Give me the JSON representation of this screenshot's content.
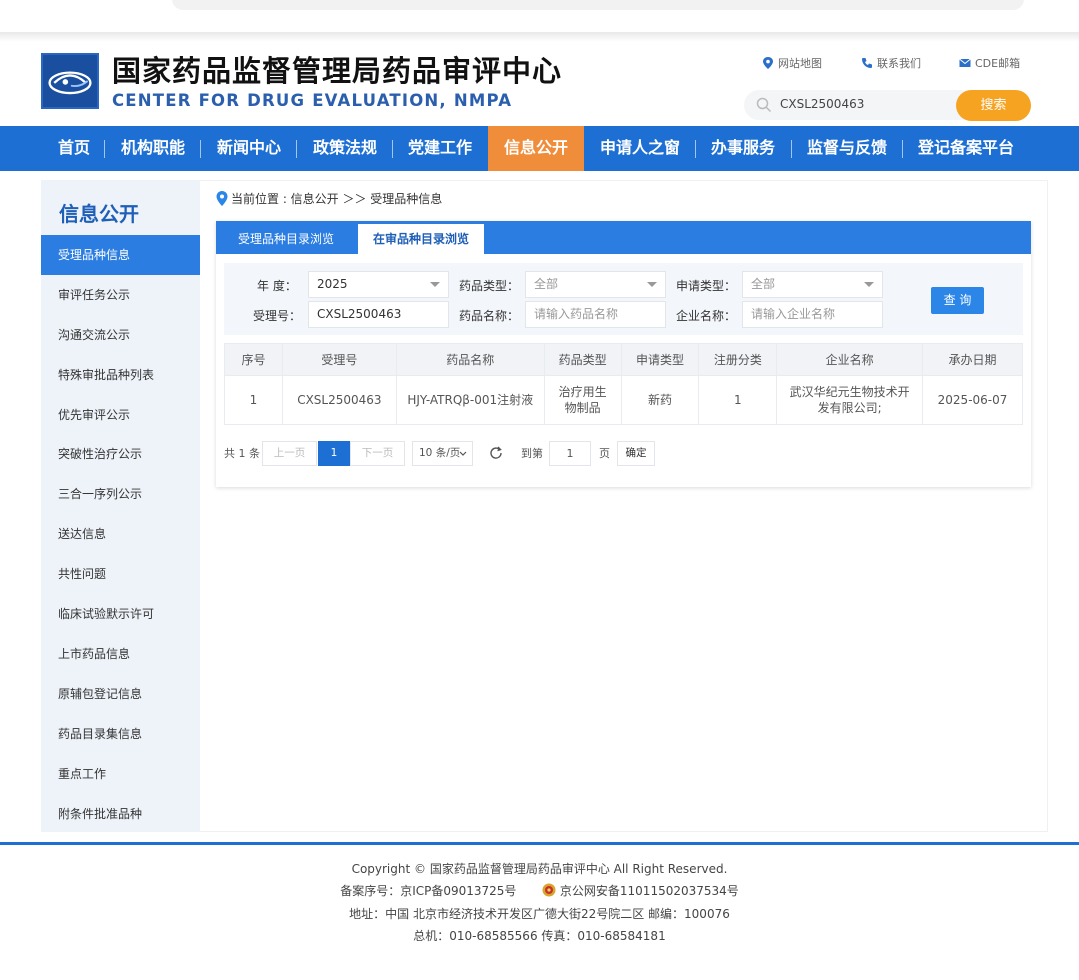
{
  "header": {
    "title": "国家药品监督管理局药品审评中心",
    "subtitle": "CENTER FOR DRUG EVALUATION, NMPA",
    "links": [
      "网站地图",
      "联系我们",
      "CDE邮箱"
    ],
    "search_value": "CXSL2500463",
    "search_button": "搜索"
  },
  "nav": [
    "首页",
    "机构职能",
    "新闻中心",
    "政策法规",
    "党建工作",
    "信息公开",
    "申请人之窗",
    "办事服务",
    "监督与反馈",
    "登记备案平台"
  ],
  "sidebar": {
    "title": "信息公开",
    "items": [
      "受理品种信息",
      "审评任务公示",
      "沟通交流公示",
      "特殊审批品种列表",
      "优先审评公示",
      "突破性治疗公示",
      "三合一序列公示",
      "送达信息",
      "共性问题",
      "临床试验默示许可",
      "上市药品信息",
      "原辅包登记信息",
      "药品目录集信息",
      "重点工作",
      "附条件批准品种"
    ]
  },
  "breadcrumb": {
    "prefix": "当前位置 : 信息公开 ＞＞ 受理品种信息"
  },
  "tabs": [
    "受理品种目录浏览",
    "在审品种目录浏览"
  ],
  "filter": {
    "year_label": "年   度：",
    "year_value": "2025",
    "drug_type_label": "药品类型：",
    "drug_type_value": "全部",
    "apply_type_label": "申请类型：",
    "apply_type_value": "全部",
    "accept_no_label": "受理号：",
    "accept_no_value": "CXSL2500463",
    "drug_name_label": "药品名称：",
    "drug_name_placeholder": "请输入药品名称",
    "company_label": "企业名称：",
    "company_placeholder": "请输入企业名称",
    "query_button": "查 询"
  },
  "table": {
    "headers": [
      "序号",
      "受理号",
      "药品名称",
      "药品类型",
      "申请类型",
      "注册分类",
      "企业名称",
      "承办日期"
    ],
    "rows": [
      [
        "1",
        "CXSL2500463",
        "HJY-ATRQβ-001注射液",
        "治疗用生物制品",
        "新药",
        "1",
        "武汉华纪元生物技术开发有限公司;",
        "2025-06-07"
      ]
    ]
  },
  "pager": {
    "total": "共 1 条",
    "prev": "上一页",
    "current": "1",
    "next": "下一页",
    "page_size": "10 条/页",
    "goto_label": "到第",
    "goto_value": "1",
    "page_unit": "页",
    "confirm": "确定"
  },
  "footer": {
    "copyright": "Copyright © 国家药品监督管理局药品审评中心   All Right Reserved.",
    "icp": "备案序号：京ICP备09013725号",
    "police": "京公网安备11011502037534号",
    "address": "地址：中国 北京市经济技术开发区广德大街22号院二区       邮编：100076",
    "phone": "总机：010-68585566       传真：010-68584181"
  },
  "colors": {
    "brand_blue": "#1e6fd3",
    "nav_active": "#ef8d3a",
    "search_button": "#f7a322"
  }
}
